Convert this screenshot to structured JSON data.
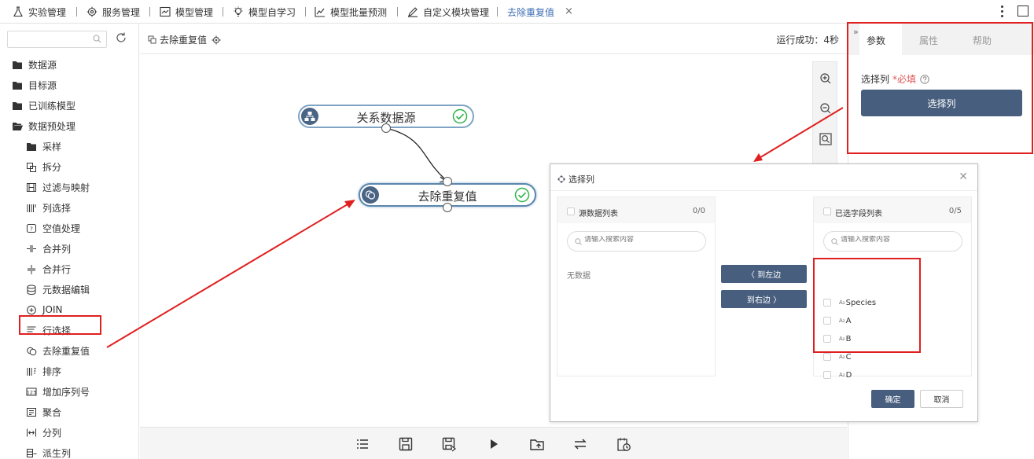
{
  "topnav": {
    "items": [
      {
        "label": "实验管理",
        "icon": "flask-icon"
      },
      {
        "label": "服务管理",
        "icon": "gear-service-icon"
      },
      {
        "label": "模型管理",
        "icon": "chart-card-icon"
      },
      {
        "label": "模型自学习",
        "icon": "bulb-icon"
      },
      {
        "label": "模型批量预测",
        "icon": "line-chart-icon"
      },
      {
        "label": "自定义模块管理",
        "icon": "edit-icon"
      }
    ],
    "active_tab": "去除重复值",
    "close": "×"
  },
  "sidebar": {
    "search_placeholder": "",
    "tree": [
      {
        "label": "数据源",
        "icon": "folder-icon",
        "level": 0
      },
      {
        "label": "目标源",
        "icon": "folder-icon",
        "level": 0
      },
      {
        "label": "已训练模型",
        "icon": "folder-icon",
        "level": 0
      },
      {
        "label": "数据预处理",
        "icon": "folder-open-icon",
        "level": 0
      },
      {
        "label": "采样",
        "icon": "folder-icon",
        "level": 1
      },
      {
        "label": "拆分",
        "icon": "split-icon",
        "level": 1
      },
      {
        "label": "过滤与映射",
        "icon": "filter-map-icon",
        "level": 1
      },
      {
        "label": "列选择",
        "icon": "column-select-icon",
        "level": 1
      },
      {
        "label": "空值处理",
        "icon": "null-icon",
        "level": 1
      },
      {
        "label": "合并列",
        "icon": "merge-column-icon",
        "level": 1
      },
      {
        "label": "合并行",
        "icon": "merge-row-icon",
        "level": 1
      },
      {
        "label": "元数据编辑",
        "icon": "database-icon",
        "level": 1
      },
      {
        "label": "JOIN",
        "icon": "join-icon",
        "level": 1
      },
      {
        "label": "行选择",
        "icon": "row-select-icon",
        "level": 1
      },
      {
        "label": "去除重复值",
        "icon": "dedupe-icon",
        "level": 1
      },
      {
        "label": "排序",
        "icon": "sort-icon",
        "level": 1
      },
      {
        "label": "增加序列号",
        "icon": "sequence-icon",
        "level": 1
      },
      {
        "label": "聚合",
        "icon": "aggregate-icon",
        "level": 1
      },
      {
        "label": "分列",
        "icon": "split-column-icon",
        "level": 1
      },
      {
        "label": "派生列",
        "icon": "derive-column-icon",
        "level": 1
      }
    ]
  },
  "canvas": {
    "title": "去除重复值",
    "run_status": "运行成功：4秒",
    "nodes": [
      {
        "label": "关系数据源"
      },
      {
        "label": "去除重复值"
      }
    ]
  },
  "right_panel": {
    "tabs": [
      "参数",
      "属性",
      "帮助"
    ],
    "active_tab": "参数",
    "field_label": "选择列",
    "required_text": "*必填",
    "select_button": "选择列"
  },
  "dialog": {
    "title": "选择列",
    "left_list": {
      "title": "源数据列表",
      "count": "0/0",
      "search_placeholder": "请输入搜索内容",
      "empty_text": "无数据"
    },
    "right_list": {
      "title": "已选字段列表",
      "count": "0/5",
      "search_placeholder": "请输入搜索内容",
      "type_prefix": "A₂",
      "fields": [
        "Species",
        "A",
        "B",
        "C",
        "D"
      ]
    },
    "move_left": "〈 到左边",
    "move_right": "到右边 〉",
    "ok": "确定",
    "cancel": "取消"
  },
  "colors": {
    "accent": "#485e7e",
    "active_tab_text": "#3c6eb4",
    "highlight_red": "#e02020",
    "success_green": "#2fb54a",
    "node_border": "#7fa3c4"
  }
}
